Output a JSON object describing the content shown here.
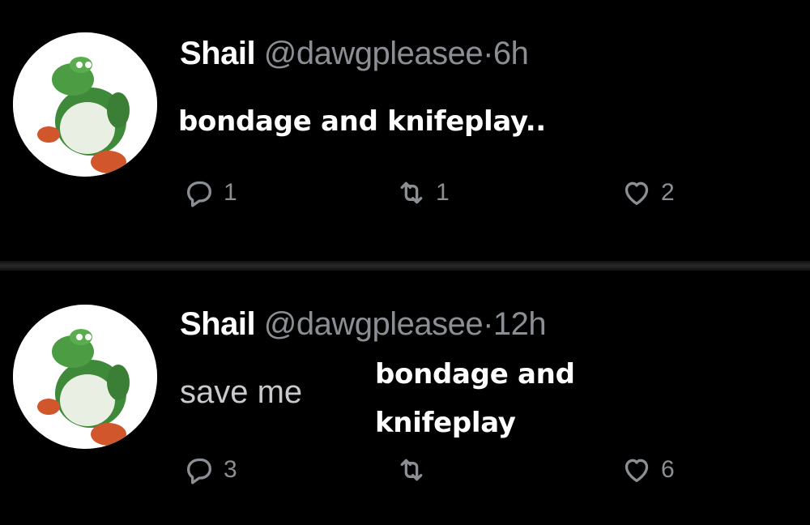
{
  "tweets": [
    {
      "display_name": "Shail",
      "handle": "@dawgpleasee",
      "separator": "·",
      "time": "6h",
      "body": "bondage and knifeplay..",
      "replies": "1",
      "retweets": "1",
      "likes": "2"
    },
    {
      "display_name": "Shail",
      "handle": "@dawgpleasee",
      "separator": "·",
      "time": "12h",
      "body": "save me",
      "overlay_line1": "bondage and",
      "overlay_line2": "knifeplay",
      "replies": "3",
      "retweets": "",
      "likes": "6"
    }
  ],
  "colors": {
    "background": "#000000",
    "secondary_text": "#8b8f94",
    "primary_text": "#ffffff"
  },
  "icons": [
    "reply-icon",
    "retweet-icon",
    "like-icon"
  ]
}
